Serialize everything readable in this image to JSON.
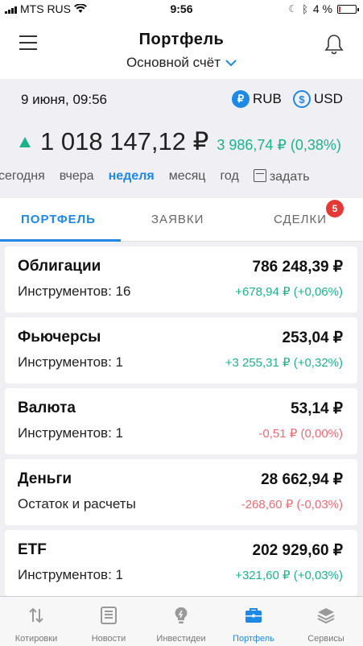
{
  "status_bar": {
    "carrier": "MTS RUS",
    "time": "9:56",
    "battery": "4 %"
  },
  "header": {
    "title": "Портфель",
    "account": "Основной счёт"
  },
  "summary": {
    "date": "9 июня, 09:56",
    "currency_rub": "RUB",
    "currency_usd": "USD",
    "total": "1 018 147,12 ₽",
    "delta": "3 986,74 ₽ (0,38%)",
    "periods": [
      "сегодня",
      "вчера",
      "неделя",
      "месяц",
      "год",
      "задать"
    ],
    "active_period": "неделя"
  },
  "tabs": {
    "portfolio": "ПОРТФЕЛЬ",
    "orders": "ЗАЯВКИ",
    "deals": "СДЕЛКИ",
    "deals_badge": "5"
  },
  "assets": [
    {
      "name": "Облигации",
      "sub": "Инструментов: 16",
      "value": "786 248,39 ₽",
      "delta": "+678,94 ₽ (+0,06%)",
      "trend": "up"
    },
    {
      "name": "Фьючерсы",
      "sub": "Инструментов: 1",
      "value": "253,04 ₽",
      "delta": "+3 255,31 ₽ (+0,32%)",
      "trend": "up"
    },
    {
      "name": "Валюта",
      "sub": "Инструментов: 1",
      "value": "53,14 ₽",
      "delta": "-0,51 ₽ (0,00%)",
      "trend": "down"
    },
    {
      "name": "Деньги",
      "sub": "Остаток и расчеты",
      "value": "28 662,94 ₽",
      "delta": "-268,60 ₽ (-0,03%)",
      "trend": "down"
    },
    {
      "name": "ETF",
      "sub": "Инструментов: 1",
      "value": "202 929,60 ₽",
      "delta": "+321,60 ₽ (+0,03%)",
      "trend": "up"
    }
  ],
  "tabbar": {
    "quotes": "Котировки",
    "news": "Новости",
    "ideas": "Инвестидеи",
    "portfolio": "Портфель",
    "services": "Сервисы"
  },
  "colors": {
    "accent": "#1e88e5",
    "positive": "#1bb38c",
    "negative": "#ef6b73",
    "badge": "#e53935"
  }
}
